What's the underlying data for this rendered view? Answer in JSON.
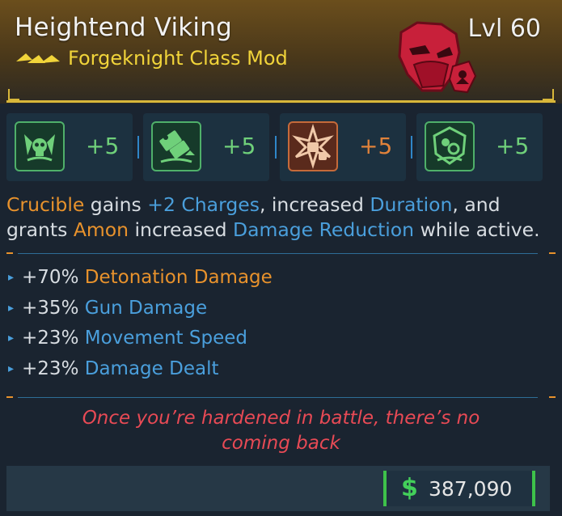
{
  "item": {
    "name": "Heightend Viking",
    "level": "Lvl 60",
    "type": "Forgeknight Class Mod"
  },
  "colors": {
    "legendary": "#f1d43a",
    "orange": "#e8922c",
    "blue": "#4a9fdc",
    "green": "#6fd07a",
    "flavor": "#e84a55",
    "money": "#43d05a"
  },
  "skills": [
    {
      "icon": "skull-wings-icon",
      "bonus": "+5"
    },
    {
      "icon": "gun-crate-icon",
      "bonus": "+5"
    },
    {
      "icon": "explosion-fist-icon",
      "bonus": "+5"
    },
    {
      "icon": "shield-cogs-icon",
      "bonus": "+5"
    }
  ],
  "description": {
    "p1": "Crucible",
    "p2": " gains ",
    "p3": "+2 Charges",
    "p4": ", increased ",
    "p5": "Duration",
    "p6": ", and grants ",
    "p7": "Amon",
    "p8": " increased ",
    "p9": "Damage Reduction",
    "p10": " while active."
  },
  "stats": [
    {
      "value": "+70%",
      "label": "Detonation Damage"
    },
    {
      "value": "+35%",
      "label": "Gun Damage"
    },
    {
      "value": "+23%",
      "label": "Movement Speed"
    },
    {
      "value": "+23%",
      "label": "Damage Dealt"
    }
  ],
  "flavor": {
    "line1": "Once you’re hardened in battle, there’s no",
    "line2": "coming back"
  },
  "price": {
    "currency": "$",
    "value": "387,090"
  }
}
